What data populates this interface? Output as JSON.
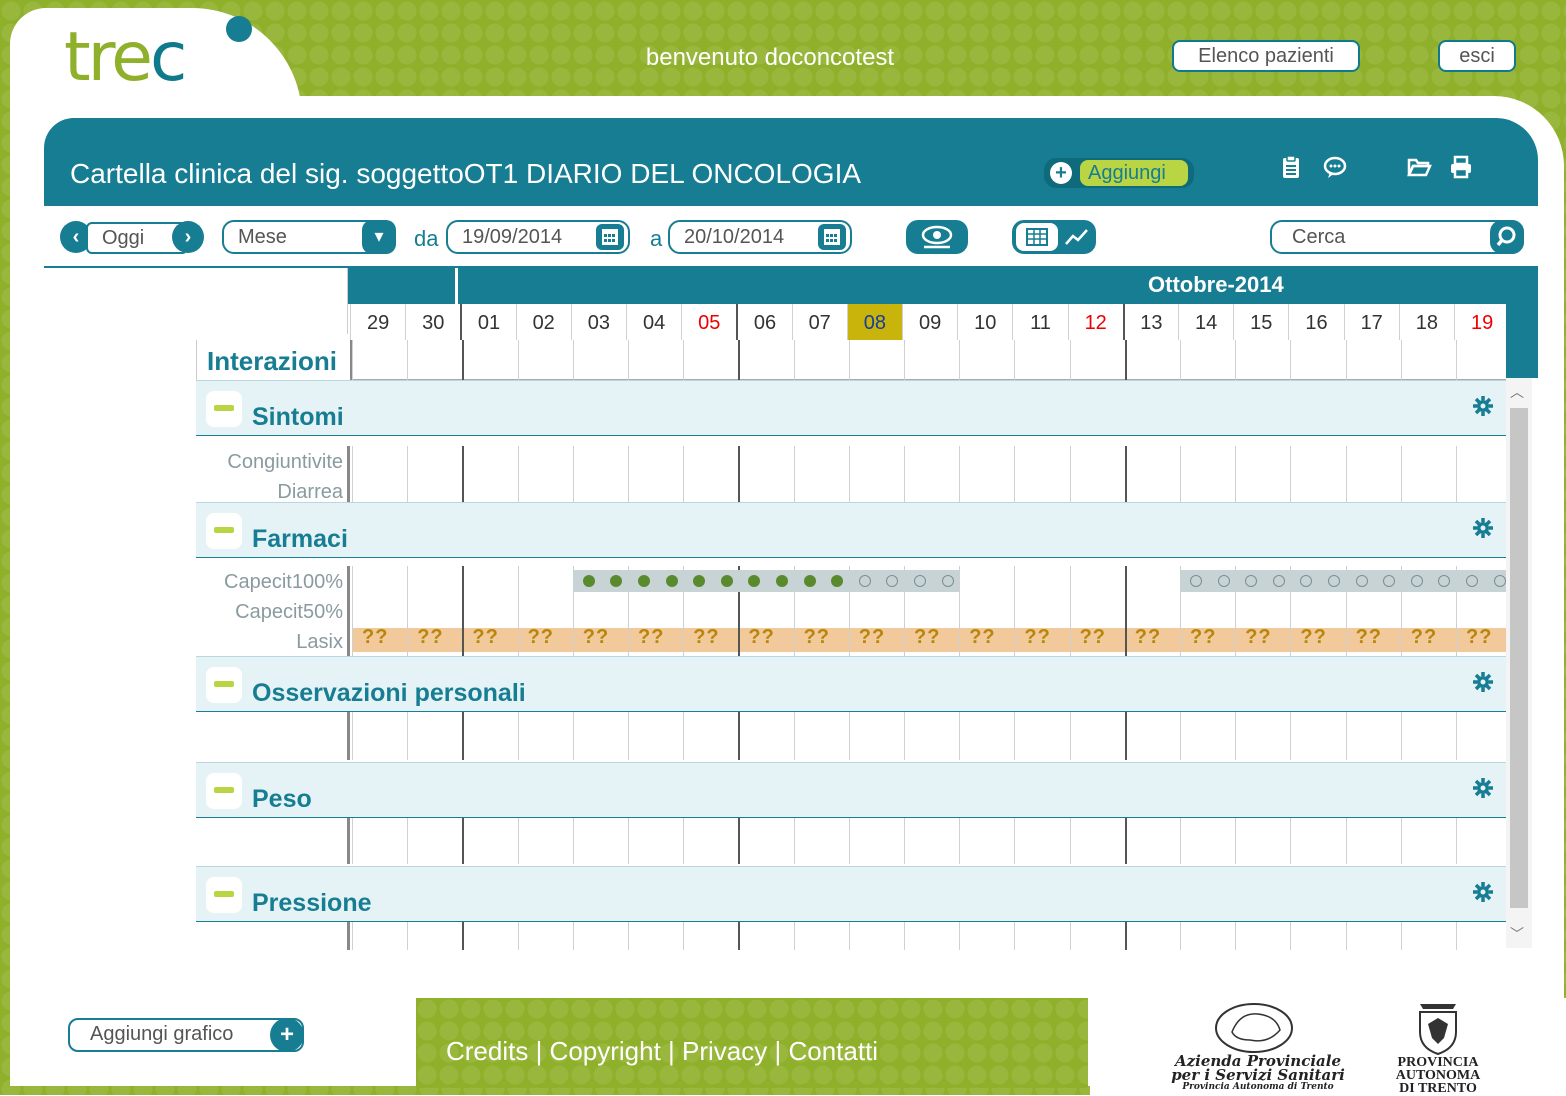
{
  "app": {
    "welcome": "benvenuto doconcotest",
    "patients_button": "Elenco pazienti",
    "logout_button": "esci"
  },
  "header": {
    "title": "Cartella clinica del sig. soggettoOT1 DIARIO DEL ONCOLOGIA",
    "add_label": "Aggiungi"
  },
  "toolbar": {
    "today": "Oggi",
    "period": "Mese",
    "from_label": "da",
    "from_date": "19/09/2014",
    "to_label": "a",
    "to_date": "20/10/2014",
    "search_placeholder": "Cerca"
  },
  "calendar": {
    "month": "Ottobre-2014",
    "days": [
      "29",
      "30",
      "01",
      "02",
      "03",
      "04",
      "05",
      "06",
      "07",
      "08",
      "09",
      "10",
      "11",
      "12",
      "13",
      "14",
      "15",
      "16",
      "17",
      "18",
      "19"
    ],
    "weekend_days": [
      "05",
      "12",
      "19"
    ],
    "today": "08",
    "week_starts": [
      "01",
      "06",
      "13"
    ]
  },
  "interactions_label": "Interazioni",
  "sections": {
    "sintomi": {
      "title": "Sintomi",
      "rows": [
        "Congiuntivite",
        "Diarrea"
      ]
    },
    "farmaci": {
      "title": "Farmaci",
      "rows": [
        "Capecit100%",
        "Capecit50%",
        "Lasix"
      ],
      "lasix_mark": "??"
    },
    "osservazioni": {
      "title": "Osservazioni personali"
    },
    "peso": {
      "title": "Peso"
    },
    "pressione": {
      "title": "Pressione"
    }
  },
  "footer": {
    "links": "Credits | Copyright | Privacy | Contatti",
    "add_graph": "Aggiungi grafico",
    "org1_line1": "Azienda Provinciale",
    "org1_line2": "per i Servizi Sanitari",
    "org1_line3": "Provincia Autonoma di Trento",
    "org2_line1": "PROVINCIA",
    "org2_line2": "AUTONOMA",
    "org2_line3": "DI TRENTO"
  },
  "colors": {
    "brand_green": "#8fb02a",
    "brand_teal": "#167d92",
    "accent_lime": "#b9d544",
    "weekend_red": "#e00000",
    "today_gold": "#c8b40a"
  }
}
